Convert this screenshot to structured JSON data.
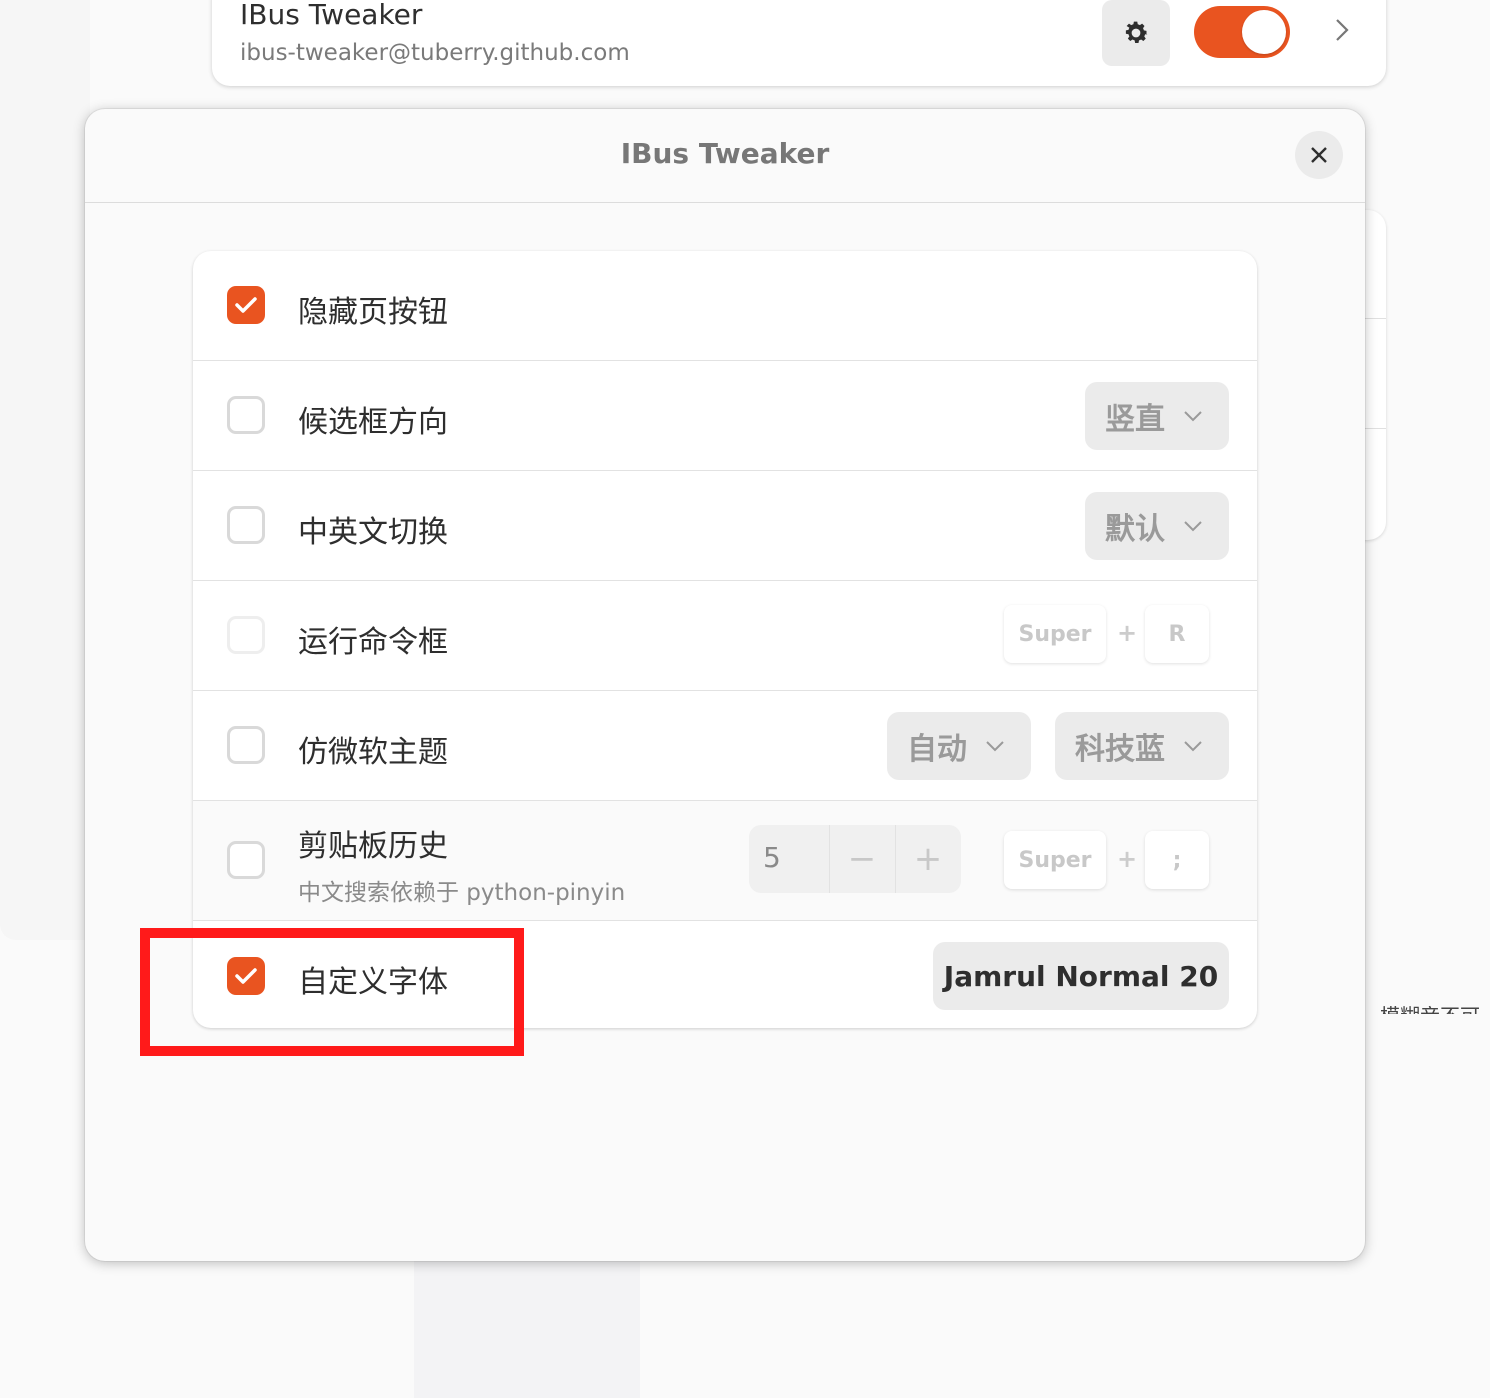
{
  "extension": {
    "name": "IBus Tweaker",
    "uuid": "ibus-tweaker@tuberry.github.com",
    "enabled": true
  },
  "background": {
    "right_text": "模糊音不可"
  },
  "dialog": {
    "title": "IBus Tweaker",
    "close_icon": "close-icon"
  },
  "settings": {
    "hide_page_buttons": {
      "label": "隐藏页按钮",
      "checked": true
    },
    "candidate_orientation": {
      "label": "候选框方向",
      "checked": false,
      "value": "竖直"
    },
    "cn_en_switch": {
      "label": "中英文切换",
      "checked": false,
      "value": "默认"
    },
    "run_dialog": {
      "label": "运行命令框",
      "checked": false,
      "key_mod": "Super",
      "key_plus": "+",
      "key": "R"
    },
    "ms_theme": {
      "label": "仿微软主题",
      "checked": false,
      "mode": "自动",
      "color": "科技蓝"
    },
    "clipboard_history": {
      "label": "剪贴板历史",
      "checked": false,
      "sublabel": "中文搜索依赖于 python-pinyin",
      "count": "5",
      "minus": "−",
      "plus": "+",
      "key_mod": "Super",
      "key_plus": "+",
      "key": ";"
    },
    "custom_font": {
      "label": "自定义字体",
      "checked": true,
      "font": "Jamrul Normal  20"
    }
  },
  "colors": {
    "accent": "#e95420",
    "highlight": "#ff1a1a"
  }
}
